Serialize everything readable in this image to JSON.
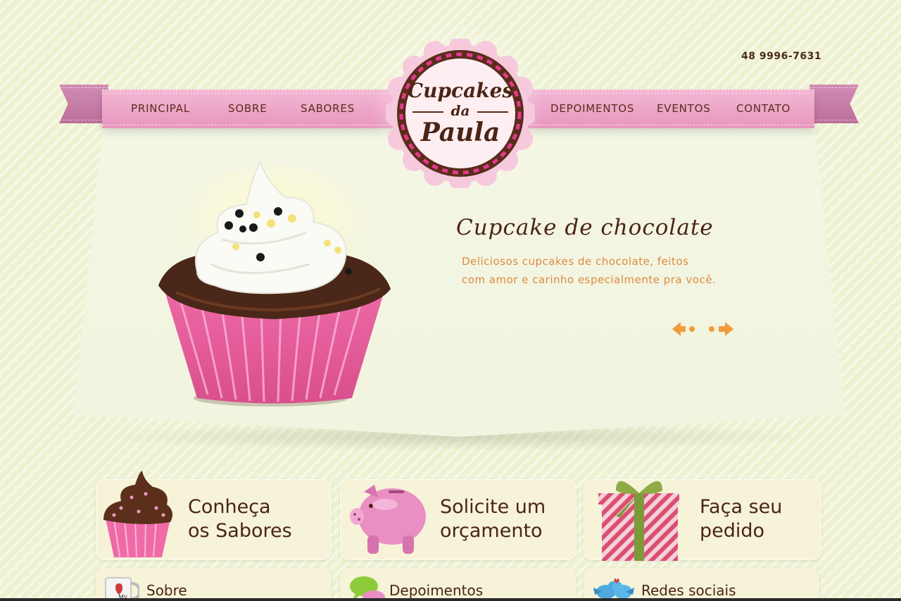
{
  "header": {
    "phone": "48 9996-7631",
    "logo": {
      "line1": "Cupcakes",
      "line2": "da",
      "line3": "Paula"
    }
  },
  "nav": {
    "left": [
      "PRINCIPAL",
      "SOBRE",
      "SABORES"
    ],
    "right": [
      "DEPOIMENTOS",
      "EVENTOS",
      "CONTATO"
    ]
  },
  "slide": {
    "title": "Cupcake de chocolate",
    "line1": "Deliciosos cupcakes de chocolate, feitos",
    "line2": "com amor e carinho especialmente pra você.",
    "prev_icon": "arrow-left-icon",
    "next_icon": "arrow-right-icon"
  },
  "cards": [
    {
      "label": "Conheça\nos Sabores",
      "icon": "chocolate-cupcake-icon"
    },
    {
      "label": "Solicite um\norçamento",
      "icon": "piggy-bank-icon"
    },
    {
      "label": "Faça seu\npedido",
      "icon": "gift-box-icon"
    }
  ],
  "small_cards": [
    {
      "label": "Sobre",
      "icon": "mug-icon"
    },
    {
      "label": "Depoimentos",
      "icon": "chat-bubble-icon"
    },
    {
      "label": "Redes sociais",
      "icon": "twitter-birds-icon"
    }
  ],
  "colors": {
    "background": "#eef2d2",
    "ribbon_pink": "#eba3c6",
    "brown": "#4b2415",
    "orange_text": "#dd8a3f",
    "card": "#f6f3d8"
  }
}
